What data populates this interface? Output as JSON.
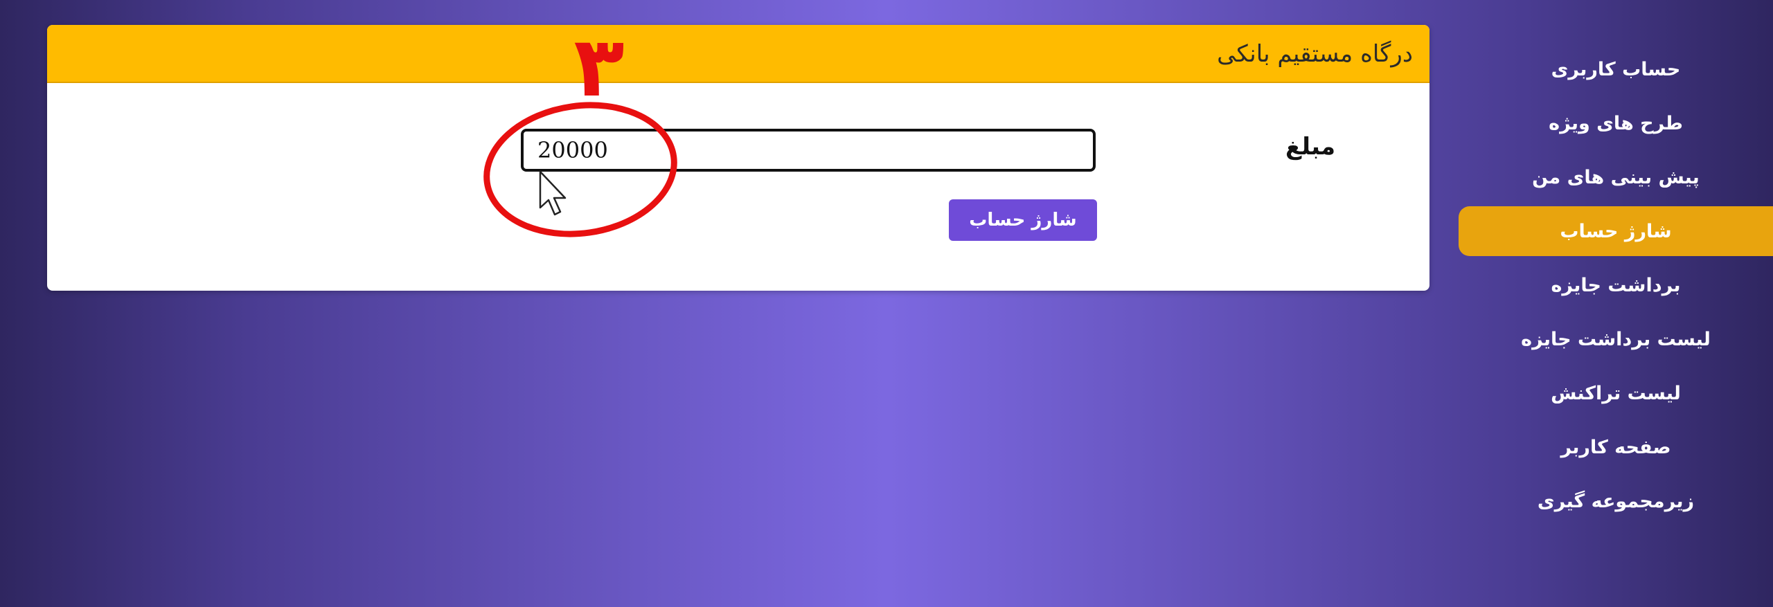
{
  "panel": {
    "title": "درگاه مستقیم بانکی",
    "amount_label": "مبلغ",
    "amount_value": "20000",
    "charge_button_label": "شارژ حساب"
  },
  "annotation": {
    "step_number": "۳",
    "color": "#e81010"
  },
  "sidebar": {
    "active_index": 3,
    "items": [
      {
        "label": "حساب کاربری"
      },
      {
        "label": "طرح های ویژه"
      },
      {
        "label": "پیش بینی های من"
      },
      {
        "label": "شارژ حساب"
      },
      {
        "label": "برداشت جایزه"
      },
      {
        "label": "لیست برداشت جایزه"
      },
      {
        "label": "لیست تراکنش"
      },
      {
        "label": "صفحه کاربر"
      },
      {
        "label": "زیرمجموعه گیری"
      }
    ]
  },
  "colors": {
    "header": "#ffbb00",
    "button": "#6f4bd8",
    "sidebar_active": "#e8a40e"
  }
}
